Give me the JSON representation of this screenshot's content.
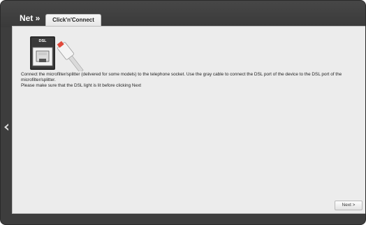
{
  "header": {
    "section_title": "Net »",
    "tab_label": "Click'n'Connect"
  },
  "device_image": {
    "port_label": "DSL"
  },
  "instructions": {
    "line1": "Connect the microfilter/splitter (delivered for some models) to the telephone socket. Use the gray cable to connect the DSL port of the device to the DSL port of the microfilter/splitter.",
    "line2": "Please make sure that the DSL light is lit before clicking Next"
  },
  "footer": {
    "next_label": "Next >"
  },
  "icons": {
    "side_arrow": "chevron-left-icon"
  }
}
